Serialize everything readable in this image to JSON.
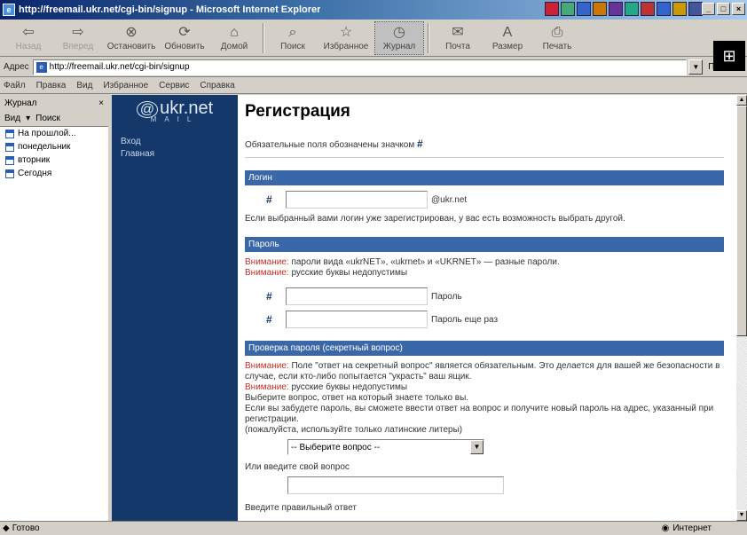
{
  "window": {
    "title": "http://freemail.ukr.net/cgi-bin/signup - Microsoft Internet Explorer",
    "btn_min": "_",
    "btn_max": "□",
    "btn_close": "×"
  },
  "toolbar": {
    "back": "Назад",
    "forward": "Вперед",
    "stop": "Остановить",
    "refresh": "Обновить",
    "home": "Домой",
    "search": "Поиск",
    "favorites": "Избранное",
    "media": "Журнал",
    "mail": "Почта",
    "print": "Размер",
    "edit": "Печать"
  },
  "address": {
    "label": "Адрес",
    "url": "http://freemail.ukr.net/cgi-bin/signup",
    "go": "Переход"
  },
  "menu": [
    "Файл",
    "Правка",
    "Вид",
    "Избранное",
    "Сервис",
    "Справка"
  ],
  "sidebar": {
    "title": "Журнал",
    "view_label": "Вид",
    "search_label": "Поиск",
    "items": [
      "На прошлой...",
      "понедельник",
      "вторник",
      "Сегодня"
    ]
  },
  "page": {
    "logo": "ukr.net",
    "logo_sub": "MAIL",
    "nav": [
      "Вход",
      "Главная"
    ],
    "heading": "Регистрация",
    "required_note": "Обязательные поля обозначены значком",
    "hash": "#",
    "login": {
      "section": "Логин",
      "suffix": "@ukr.net",
      "note": "Если выбранный вами логин уже зарегистрирован, у вас есть возможность выбрать другой."
    },
    "password": {
      "section": "Пароль",
      "warn_label": "Внимание:",
      "warn1": "пароли вида «ukrNET», «ukrnet» и «UKRNET» — разные пароли.",
      "warn2": "русские буквы недопустимы",
      "field1": "Пароль",
      "field2": "Пароль еще раз"
    },
    "secret": {
      "section": "Проверка пароля (секретный вопрос)",
      "warn_label": "Внимание:",
      "warn1": "Поле \"ответ на секретный вопрос\" является обязательным. Это делается для вашей же безопасности в случае, если кто-либо попытается \"украсть\" ваш ящик.",
      "warn2": "русские буквы недопустимы",
      "line1": "Выберите вопрос, ответ на который знаете только вы.",
      "line2": "Если вы забудете пароль, вы сможете ввести ответ на вопрос и получите новый пароль на адрес, указанный при регистрации.",
      "line3": "(пожалуйста, используйте только латинские литеры)",
      "select_value": "-- Выберите вопрос --",
      "custom_label": "Или введите свой вопрос",
      "answer_label": "Введите правильный ответ"
    }
  },
  "status": {
    "left": "Готово",
    "zone": "Интернет"
  }
}
